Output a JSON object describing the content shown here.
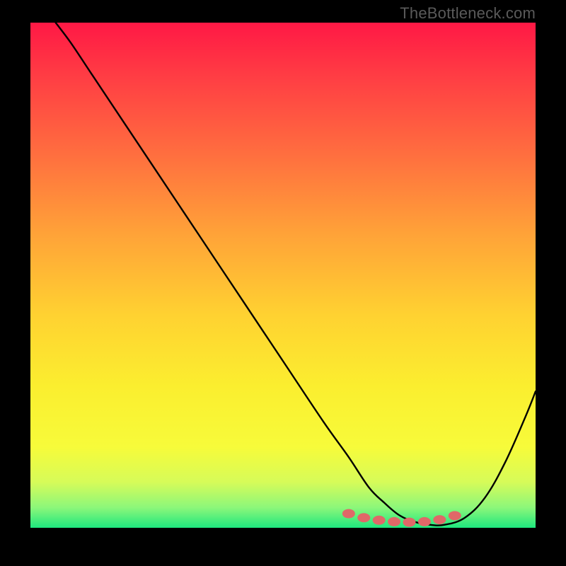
{
  "attribution": "TheBottleneck.com",
  "colors": {
    "background": "#000000",
    "gradient_top": "#ff1845",
    "gradient_mid1": "#ff6e3f",
    "gradient_mid2": "#ffd231",
    "gradient_mid3": "#f7fb3a",
    "gradient_bottom": "#1ee77e",
    "curve": "#000000",
    "marker_fill": "#e06868",
    "marker_stroke": "#b24a4a"
  },
  "chart_data": {
    "type": "line",
    "title": "",
    "xlabel": "",
    "ylabel": "",
    "xlim": [
      0,
      100
    ],
    "ylim": [
      0,
      100
    ],
    "grid": false,
    "legend": false,
    "series": [
      {
        "name": "bottleneck-curve",
        "x": [
          5,
          8,
          12,
          18,
          26,
          34,
          42,
          50,
          58,
          63,
          67,
          70,
          73,
          76,
          79,
          82,
          86,
          90,
          94,
          98,
          100
        ],
        "values": [
          100,
          96,
          90,
          81,
          69,
          57,
          45,
          33,
          21,
          14,
          8,
          5,
          2.5,
          1.2,
          0.6,
          0.6,
          2,
          6,
          13,
          22,
          27
        ]
      }
    ],
    "markers": {
      "name": "highlighted-points",
      "x": [
        63,
        66,
        69,
        72,
        75,
        78,
        81,
        84
      ],
      "values": [
        2.8,
        2.0,
        1.5,
        1.2,
        1.1,
        1.2,
        1.6,
        2.4
      ]
    }
  }
}
